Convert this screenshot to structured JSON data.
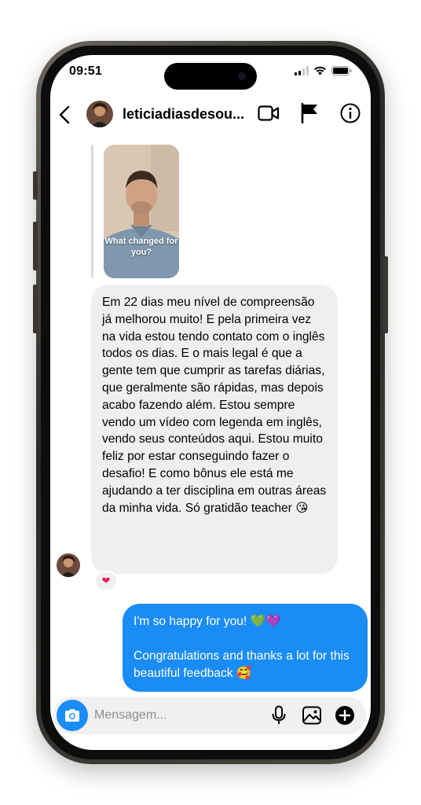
{
  "status": {
    "time": "09:51"
  },
  "header": {
    "username": "leticiadiasdesou...",
    "icons": [
      "back-arrow-icon",
      "video-call-icon",
      "flag-icon",
      "info-icon"
    ]
  },
  "chat": {
    "story_reply": {
      "caption": "What changed for you?"
    },
    "incoming_message": "Em 22 dias meu nível de compreensão já melhorou muito! E pela primeira vez na vida estou tendo contato com o inglês todos os dias. E o mais legal é que a gente tem que cumprir as tarefas diárias, que geralmente são rápidas, mas depois acabo fazendo além. Estou sempre vendo um vídeo com legenda em inglês, vendo seus conteúdos aqui. Estou muito feliz por estar conseguindo fazer o desafio! E como bônus ele está me ajudando a ter disciplina em outras áreas da minha vida. Só gratidão teacher 😘",
    "reaction": "❤",
    "outgoing_message": {
      "line1": "I'm so happy for you! 💚💜",
      "line2": "Congratulations and thanks a lot for this beautiful feedback 🥰"
    }
  },
  "composer": {
    "placeholder": "Mensagem...",
    "icons": [
      "camera-icon",
      "microphone-icon",
      "gallery-icon",
      "add-icon"
    ]
  },
  "colors": {
    "accent": "#1a8cf6",
    "incoming_bubble": "#efefef",
    "reaction": "#e0245e"
  }
}
